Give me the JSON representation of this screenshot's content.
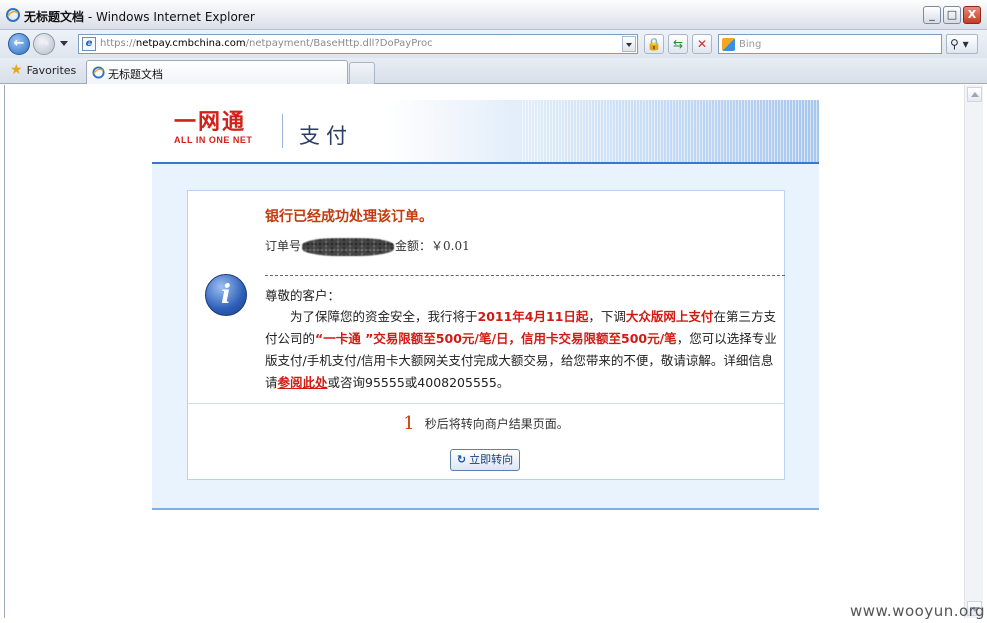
{
  "window": {
    "title_doc": "无标题文档",
    "title_app": " - Windows Internet Explorer",
    "buttons": [
      "_",
      "□",
      "X"
    ]
  },
  "toolbar": {
    "url_prefix": "https://",
    "url_host": "netpay.cmbchina.com",
    "url_path": "/netpayment/BaseHttp.dll?DoPayProc",
    "search_placeholder": "Bing",
    "favicon": "e"
  },
  "tabs": {
    "favorites_label": "Favorites",
    "active_tab_label": "无标题文档"
  },
  "page": {
    "logo_cn": "一网通",
    "logo_en": "ALL IN ONE NET",
    "banner_title": "支付",
    "success_message": "银行已经成功处理该订单。",
    "order_label": "订单号",
    "amount_text": "金额：￥0.01",
    "greeting": "尊敬的客户：",
    "notice": {
      "p1": "为了保障您的资金安全，我行将于",
      "date": "2011年4月11日起",
      "p2": "，下调",
      "channel": "大众版网上支付",
      "p3": "在第三方支付公司的",
      "limits": "“一卡通 ”交易限额至500元/笔/日，信用卡交易限额至500元/笔",
      "p4": "，您可以选择专业版支付/手机支付/信用卡大额网关支付完成大额交易，给您带来的不便，敬请谅解。详细信息请",
      "link": "参阅此处",
      "p5": "或咨询95555或4008205555。"
    },
    "countdown_number": "1",
    "countdown_text": "秒后将转向商户结果页面。",
    "redirect_button": "立即转向"
  },
  "watermark": "www.wooyun.org",
  "colors": {
    "accent_red": "#d31a12",
    "banner_blue": "#3878c8",
    "content_bg": "#e8f3fd"
  },
  "icons": [
    "ie-icon",
    "back-arrow-icon",
    "forward-arrow-icon",
    "lock-icon",
    "refresh-icon",
    "stop-icon",
    "bing-icon",
    "search-icon",
    "star-icon",
    "info-icon",
    "redirect-arrow-icon"
  ]
}
